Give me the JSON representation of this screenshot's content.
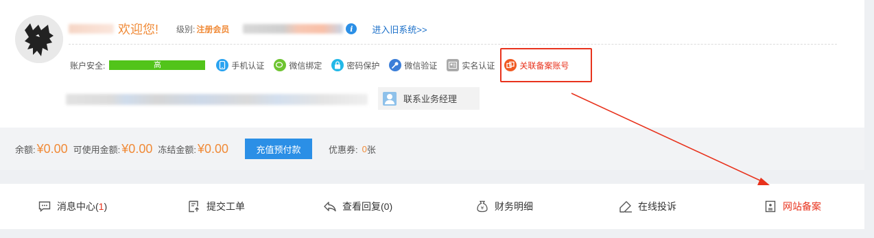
{
  "header": {
    "welcome": "欢迎您!",
    "level_label": "级别:",
    "level_value": "注册会员",
    "old_system_link": "进入旧系统>>"
  },
  "security": {
    "label": "账户安全:",
    "level": "高",
    "auth_items": [
      {
        "label": "手机认证",
        "icon": "phone-icon"
      },
      {
        "label": "微信绑定",
        "icon": "wechat-icon"
      },
      {
        "label": "密码保护",
        "icon": "lock-icon"
      },
      {
        "label": "微信验证",
        "icon": "key-icon"
      },
      {
        "label": "实名认证",
        "icon": "id-card-icon"
      },
      {
        "label": "关联备案账号",
        "icon": "link-account-icon"
      }
    ]
  },
  "manager_button": "联系业务经理",
  "balance": {
    "balance_label": "余额:",
    "balance_value": "¥0.00",
    "available_label": "可使用金额:",
    "available_value": "¥0.00",
    "frozen_label": "冻结金额:",
    "frozen_value": "¥0.00",
    "recharge_button": "充值预付款",
    "coupon_label": "优惠券:",
    "coupon_count": "0",
    "coupon_unit": "张"
  },
  "nav": {
    "items": [
      {
        "label": "消息中心(",
        "count": "1",
        "suffix": ")",
        "icon": "message-icon"
      },
      {
        "label": "提交工单",
        "icon": "ticket-icon"
      },
      {
        "label": "查看回复",
        "count": " (0)",
        "icon": "reply-icon"
      },
      {
        "label": "财务明细",
        "icon": "finance-icon"
      },
      {
        "label": "在线投诉",
        "icon": "complaint-icon"
      },
      {
        "label": "网站备案",
        "icon": "filing-icon"
      }
    ]
  },
  "colors": {
    "accent_orange": "#f08a37",
    "link_blue": "#1a6fc9",
    "button_blue": "#2b8fe6",
    "security_green": "#52c41a",
    "highlight_red": "#e8321c"
  }
}
